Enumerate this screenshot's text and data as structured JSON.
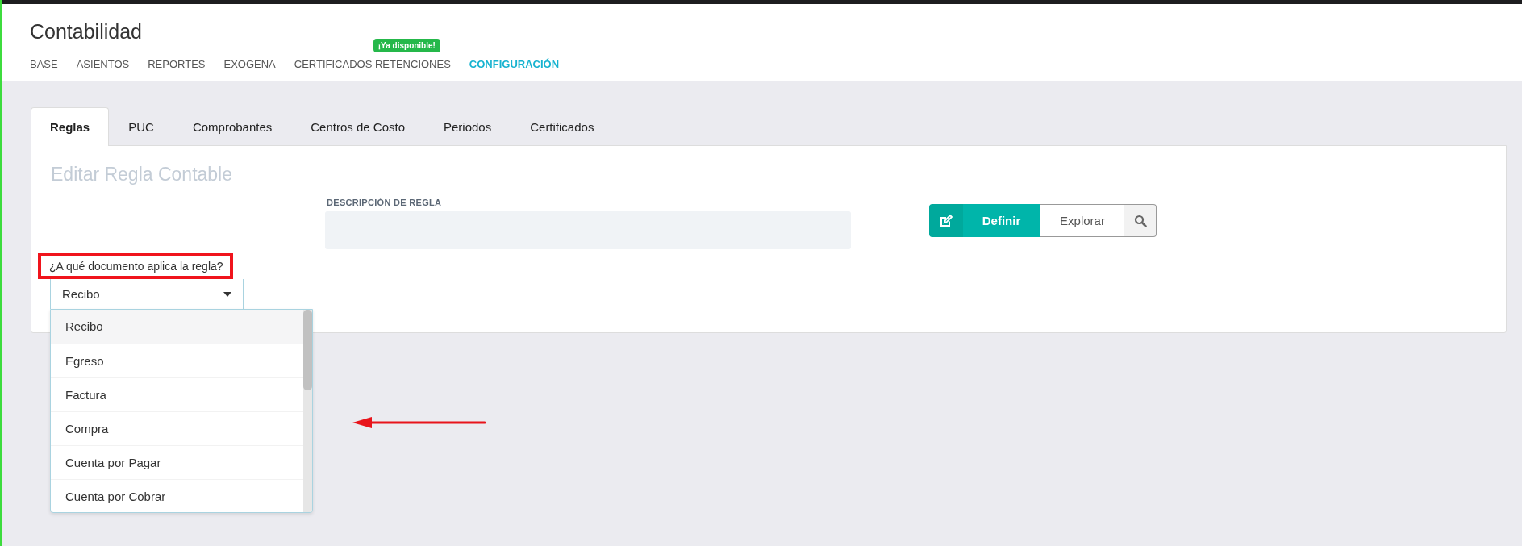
{
  "app_title": "Contabilidad",
  "nav": [
    {
      "label": "BASE",
      "selected": false
    },
    {
      "label": "ASIENTOS",
      "selected": false
    },
    {
      "label": "REPORTES",
      "selected": false
    },
    {
      "label": "EXOGENA",
      "selected": false
    },
    {
      "label": "CERTIFICADOS RETENCIONES",
      "selected": false,
      "badge": "¡Ya disponible!"
    },
    {
      "label": "CONFIGURACIÓN",
      "selected": true
    }
  ],
  "tabs": [
    {
      "label": "Reglas",
      "selected": true
    },
    {
      "label": "PUC",
      "selected": false
    },
    {
      "label": "Comprobantes",
      "selected": false
    },
    {
      "label": "Centros de Costo",
      "selected": false
    },
    {
      "label": "Periodos",
      "selected": false
    },
    {
      "label": "Certificados",
      "selected": false
    }
  ],
  "panel": {
    "title": "Editar Regla Contable",
    "description_field": {
      "label": "DESCRIPCIÓN DE REGLA"
    },
    "buttons": [
      {
        "label": "Definir",
        "kind": "primary"
      },
      {
        "label": "Explorar",
        "kind": "secondary"
      }
    ],
    "document_question": {
      "label": "¿A qué documento aplica la regla?",
      "highlighted": true,
      "value": "Recibo",
      "expanded": true,
      "options": [
        {
          "label": "Recibo",
          "selected": true
        },
        {
          "label": "Egreso",
          "selected": false
        },
        {
          "label": "Factura",
          "selected": false
        },
        {
          "label": "Compra",
          "selected": false
        },
        {
          "label": "Cuenta por Pagar",
          "selected": false
        },
        {
          "label": "Cuenta por Cobrar",
          "selected": false
        }
      ]
    }
  }
}
